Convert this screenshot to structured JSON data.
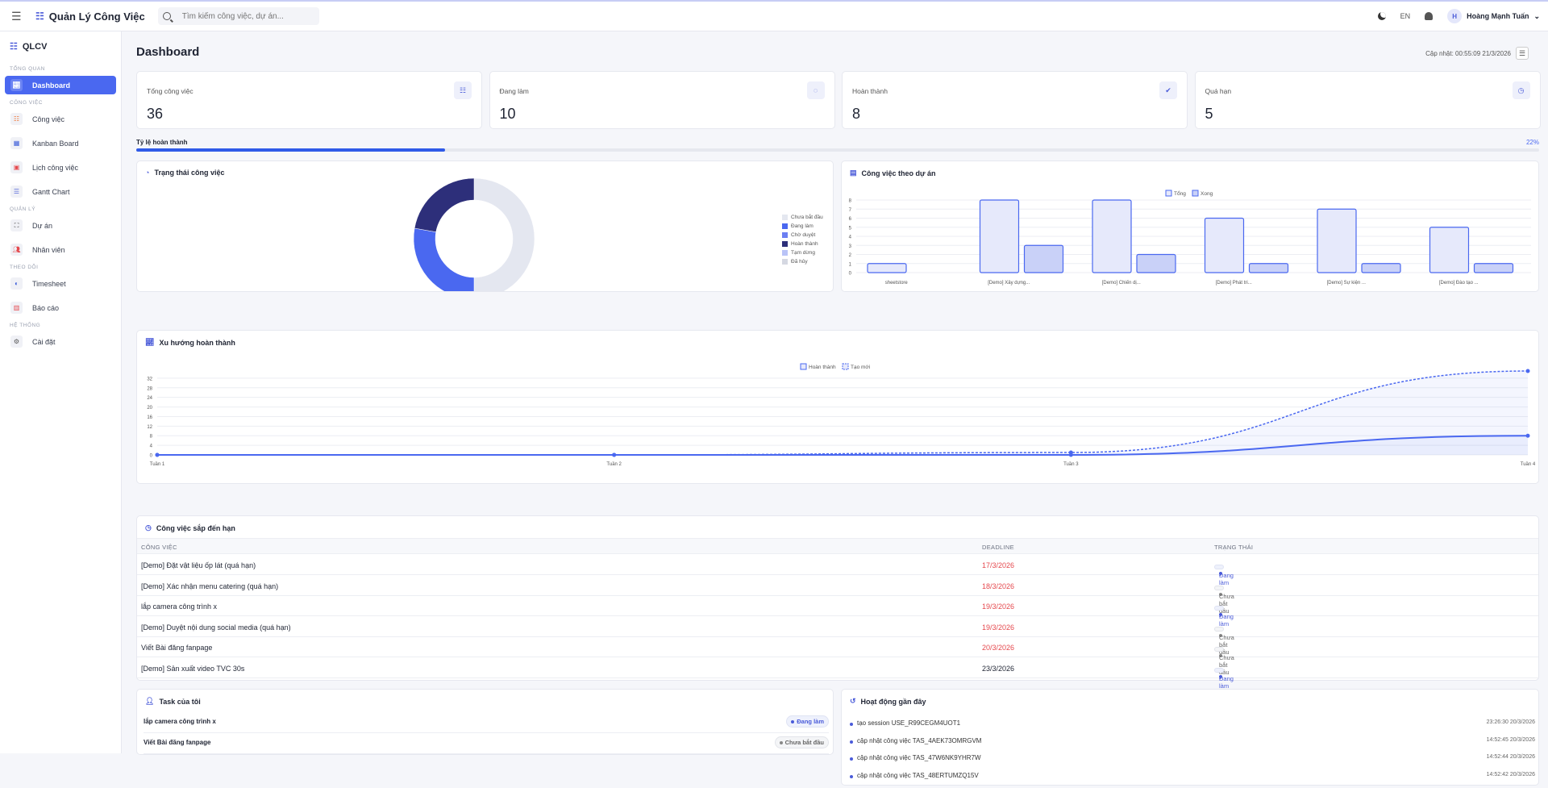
{
  "topbar": {
    "app_title": "Quản Lý Công Việc",
    "search_placeholder": "Tìm kiếm công việc, dự án...",
    "lang": "EN",
    "avatar_initial": "H",
    "user_name": "Hoàng Mạnh Tuấn"
  },
  "sidebar": {
    "logo": "QLCV",
    "sections": [
      {
        "title": "TỔNG QUAN",
        "items": [
          {
            "label": "Dashboard",
            "icon": "chart-icon",
            "active": true
          }
        ]
      },
      {
        "title": "CÔNG VIỆC",
        "items": [
          {
            "label": "Công việc",
            "icon": "task-list-icon"
          },
          {
            "label": "Kanban Board",
            "icon": "kanban-icon"
          },
          {
            "label": "Lịch công việc",
            "icon": "calendar-icon"
          },
          {
            "label": "Gantt Chart",
            "icon": "gantt-icon"
          }
        ]
      },
      {
        "title": "QUẢN LÝ",
        "items": [
          {
            "label": "Dự án",
            "icon": "project-icon"
          },
          {
            "label": "Nhân viên",
            "icon": "people-icon"
          }
        ]
      },
      {
        "title": "THEO DÕI",
        "items": [
          {
            "label": "Timesheet",
            "icon": "timesheet-icon"
          },
          {
            "label": "Báo cáo",
            "icon": "report-icon"
          }
        ]
      },
      {
        "title": "HỆ THỐNG",
        "items": [
          {
            "label": "Cài đặt",
            "icon": "settings-icon"
          }
        ]
      }
    ]
  },
  "page": {
    "title": "Dashboard",
    "updated": "Cập nhật: 00:55:09 21/3/2026"
  },
  "stats": [
    {
      "label": "Tổng công việc",
      "value": "36",
      "icon": "list-icon"
    },
    {
      "label": "Đang làm",
      "value": "10",
      "icon": "spinner-icon"
    },
    {
      "label": "Hoàn thành",
      "value": "8",
      "icon": "check-circle-icon"
    },
    {
      "label": "Quá hạn",
      "value": "5",
      "icon": "clock-icon"
    }
  ],
  "progress": {
    "label": "Tỷ lệ hoàn thành",
    "percent_text": "22%",
    "value": 0.22
  },
  "colors": {
    "accent": "#4a68f0",
    "navy": "#2d2f7a",
    "light": "#e4e7f0",
    "red": "#e5484d"
  },
  "status_chart": {
    "title": "Trạng thái công việc",
    "chart_data": {
      "type": "pie",
      "labels": [
        "Chưa bắt đầu",
        "Đang làm",
        "Chờ duyệt",
        "Hoàn thành",
        "Tạm dừng",
        "Đã hủy"
      ],
      "values": [
        18,
        10,
        0,
        8,
        0,
        0
      ],
      "colors": [
        "#e4e7f0",
        "#4a68f0",
        "#6c7ff2",
        "#2d2f7a",
        "#b9c3f7",
        "#d5d8e2"
      ]
    }
  },
  "project_chart": {
    "title": "Công việc theo dự án",
    "chart_data": {
      "type": "bar",
      "categories": [
        "sheetstore",
        "[Demo] Xây dựng...",
        "[Demo] Chiến dị...",
        "[Demo] Phát tri...",
        "[Demo] Sự kiện ...",
        "[Demo] Đào tạo ..."
      ],
      "series": [
        {
          "name": "Tổng",
          "values": [
            1,
            8,
            8,
            6,
            7,
            5
          ]
        },
        {
          "name": "Xong",
          "values": [
            0,
            3,
            2,
            1,
            1,
            1
          ]
        }
      ],
      "ylim": [
        0,
        8
      ],
      "yticks": [
        0,
        1,
        2,
        3,
        4,
        5,
        6,
        7,
        8
      ]
    }
  },
  "trend_chart": {
    "title": "Xu hướng hoàn thành",
    "chart_data": {
      "type": "line",
      "x": [
        "Tuần 1",
        "Tuần 2",
        "Tuần 3",
        "Tuần 4"
      ],
      "series": [
        {
          "name": "Hoàn thành",
          "values": [
            0,
            0,
            0,
            8
          ]
        },
        {
          "name": "Tạo mới",
          "values": [
            0,
            0,
            1,
            35
          ]
        }
      ],
      "ylim": [
        0,
        35
      ],
      "yticks": [
        0,
        4,
        8,
        12,
        16,
        20,
        24,
        28,
        32
      ]
    }
  },
  "deadlines": {
    "title": "Công việc sắp đến hạn",
    "headers": [
      "CÔNG VIỆC",
      "DEADLINE",
      "TRẠNG THÁI"
    ],
    "rows": [
      {
        "task": "[Demo] Đặt vật liệu ốp lát (quá hạn)",
        "deadline": "17/3/2026",
        "status": "Đang làm",
        "overdue": true
      },
      {
        "task": "[Demo] Xác nhận menu catering (quá hạn)",
        "deadline": "18/3/2026",
        "status": "Chưa bắt đầu",
        "overdue": true
      },
      {
        "task": "lắp camera công trình x",
        "deadline": "19/3/2026",
        "status": "Đang làm",
        "overdue": true
      },
      {
        "task": "[Demo] Duyệt nội dung social media (quá hạn)",
        "deadline": "19/3/2026",
        "status": "Chưa bắt đầu",
        "overdue": true
      },
      {
        "task": "Viết Bài đăng fanpage",
        "deadline": "20/3/2026",
        "status": "Chưa bắt đầu",
        "overdue": true
      },
      {
        "task": "[Demo] Sản xuất video TVC 30s",
        "deadline": "23/3/2026",
        "status": "Đang làm",
        "overdue": false
      }
    ]
  },
  "my_tasks": {
    "title": "Task của tôi",
    "rows": [
      {
        "task": "lắp camera công trình x",
        "status": "Đang làm"
      },
      {
        "task": "Viết Bài đăng fanpage",
        "status": "Chưa bắt đầu"
      }
    ]
  },
  "activity": {
    "title": "Hoạt động gần đây",
    "rows": [
      {
        "text": "tạo session USE_R99CEGM4UOT1",
        "time": "23:26:30 20/3/2026"
      },
      {
        "text": "cập nhật công việc TAS_4AEK73OMRGVM",
        "time": "14:52:45 20/3/2026"
      },
      {
        "text": "cập nhật công việc TAS_47W6NK9YHR7W",
        "time": "14:52:44 20/3/2026"
      },
      {
        "text": "cập nhật công việc TAS_48ERTUMZQ15V",
        "time": "14:52:42 20/3/2026"
      }
    ]
  }
}
